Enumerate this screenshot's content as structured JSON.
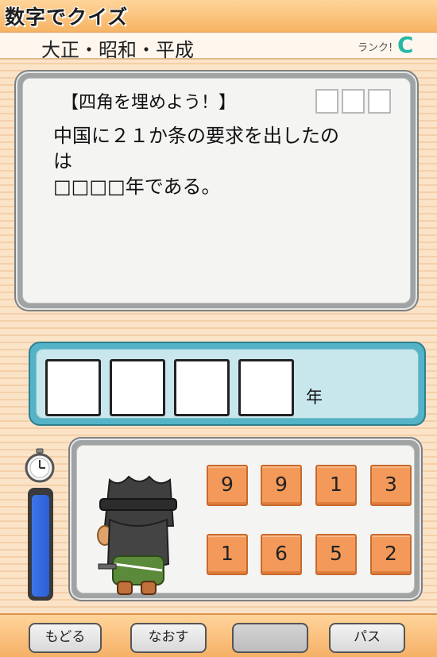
{
  "header": {
    "title": "数字でクイズ"
  },
  "subheader": {
    "category": "大正・昭和・平成",
    "rank_label": "ランク!",
    "rank_value": "C"
  },
  "question": {
    "heading": "【四角を埋めよう！】",
    "lines": [
      "中国に２１か条の要求を出したの",
      "は",
      "□□□□年である。"
    ]
  },
  "answer": {
    "unit": "年"
  },
  "timer": {
    "remaining_fraction": 0.97
  },
  "tiles": [
    "9",
    "9",
    "1",
    "3",
    "1",
    "6",
    "5",
    "2"
  ],
  "buttons": {
    "back": "もどる",
    "redo": "なおす",
    "blank": "",
    "pass": "パス"
  },
  "colors": {
    "accent_orange": "#f39a5a",
    "answer_panel": "#54b3c6",
    "timer_blue": "#2c5fd6",
    "rank_teal": "#28b7a3"
  },
  "icons": {
    "watch": "stopwatch-icon",
    "character": "ninja-character"
  }
}
